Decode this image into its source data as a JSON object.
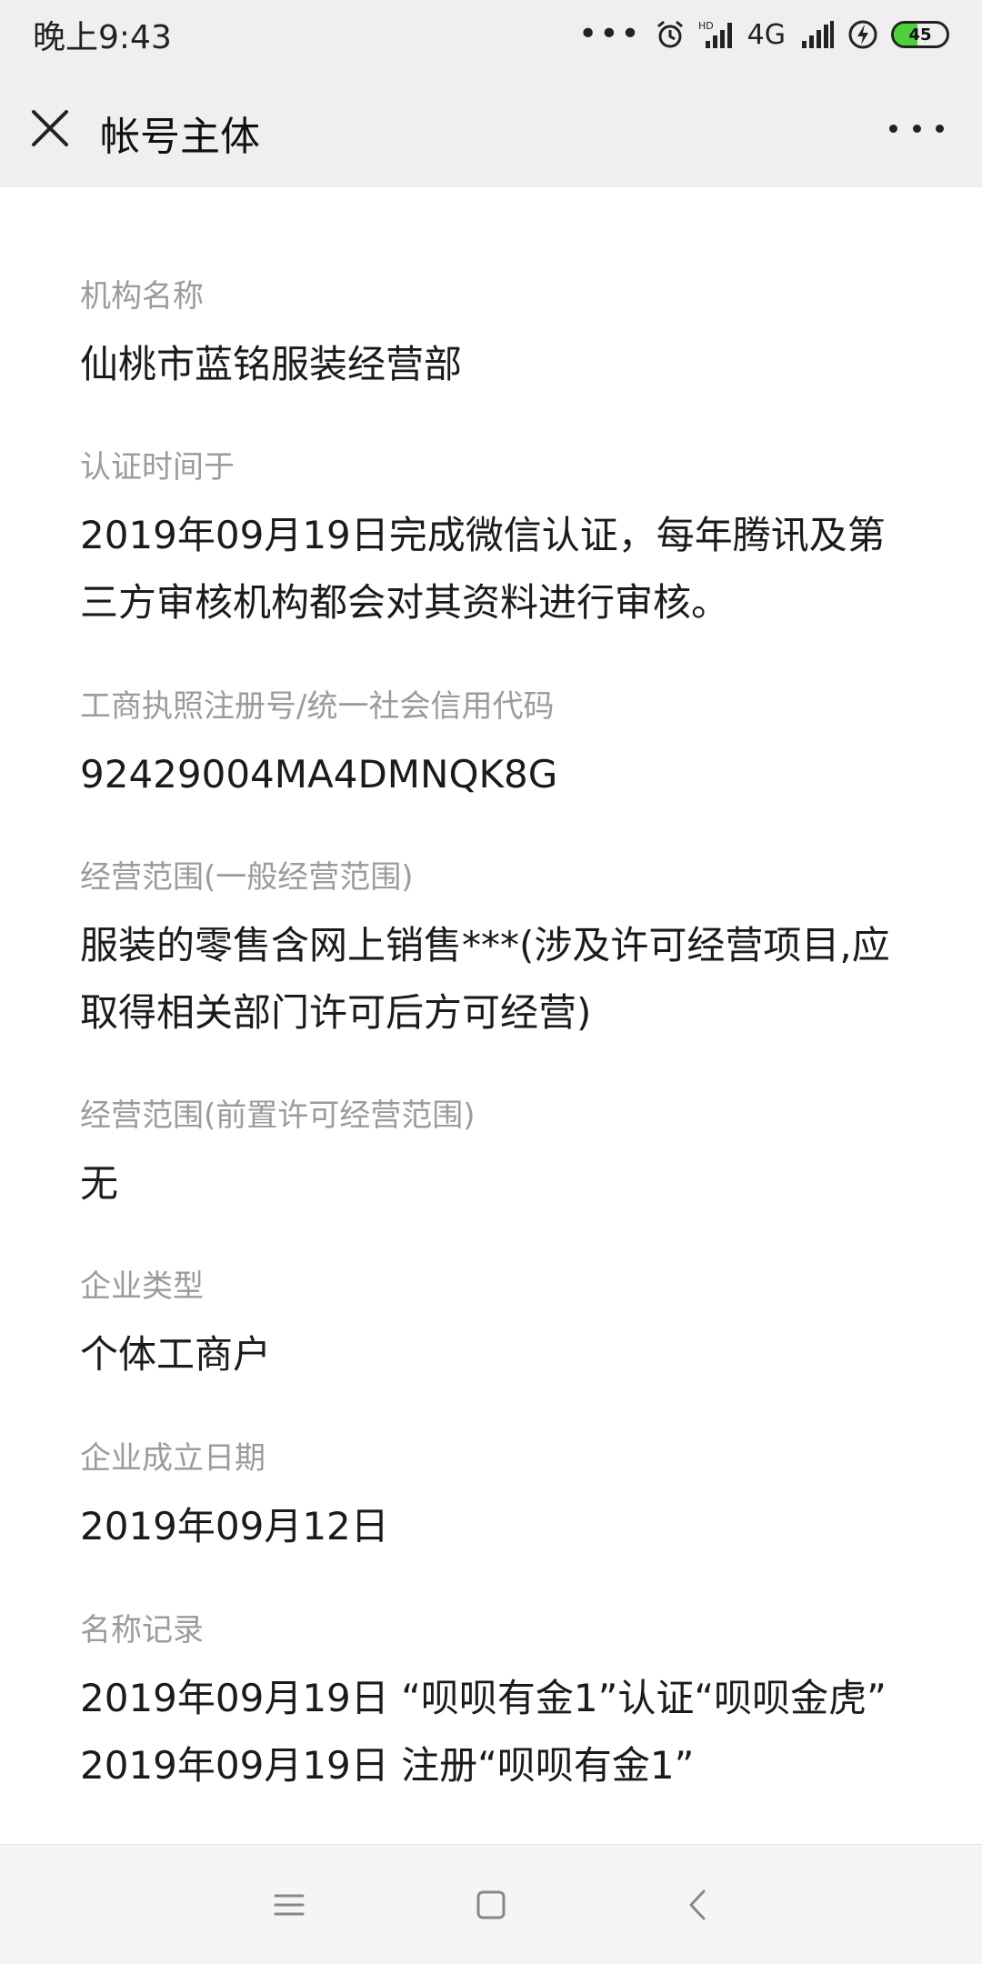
{
  "status_bar": {
    "time": "晚上9:43",
    "dots": "•••",
    "network": "4G",
    "battery_level": 45,
    "icons": [
      "more-dots-icon",
      "alarm-icon",
      "hd-signal-icon",
      "signal-icon",
      "charging-icon",
      "battery-icon"
    ]
  },
  "header": {
    "title": "帐号主体",
    "close_icon": "close-icon",
    "more_icon": "more-icon"
  },
  "sections": [
    {
      "label": "机构名称",
      "value": "仙桃市蓝铭服装经营部"
    },
    {
      "label": "认证时间于",
      "value": "2019年09月19日完成微信认证，每年腾讯及第三方审核机构都会对其资料进行审核。"
    },
    {
      "label": "工商执照注册号/统一社会信用代码",
      "value": "92429004MA4DMNQK8G"
    },
    {
      "label": "经营范围(一般经营范围)",
      "value": "服装的零售含网上销售***(涉及许可经营项目,应取得相关部门许可后方可经营)"
    },
    {
      "label": "经营范围(前置许可经营范围)",
      "value": "无"
    },
    {
      "label": "企业类型",
      "value": "个体工商户"
    },
    {
      "label": "企业成立日期",
      "value": "2019年09月12日"
    },
    {
      "label": "名称记录",
      "lines": [
        "2019年09月19日 “呗呗有金1”认证“呗呗金虎”",
        "2019年09月19日 注册“呗呗有金1”"
      ]
    }
  ],
  "nav_bar": {
    "icons": [
      "menu-icon",
      "home-icon",
      "back-icon"
    ]
  },
  "colors": {
    "header_bg": "#efefef",
    "label": "#9b9b9b",
    "value": "#1b1b1b",
    "battery": "#4cd137"
  }
}
